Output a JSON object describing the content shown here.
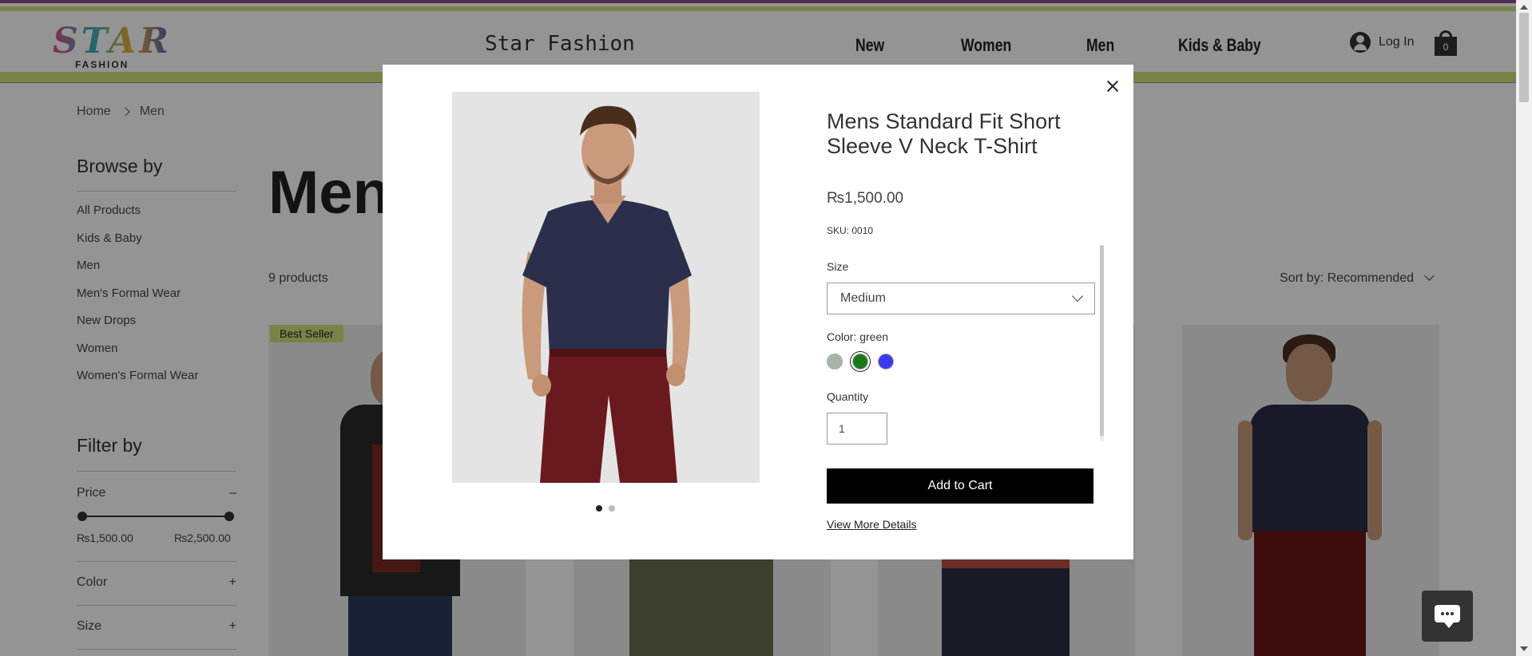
{
  "header": {
    "logo_text": "STAR",
    "logo_sub": "FASHION",
    "site_title": "Star Fashion",
    "nav": [
      "New",
      "Women",
      "Men",
      "Kids & Baby"
    ],
    "login_label": "Log In",
    "cart_count": "0"
  },
  "breadcrumb": [
    "Home",
    "Men"
  ],
  "sidebar": {
    "browse_title": "Browse by",
    "categories": [
      "All Products",
      "Kids & Baby",
      "Men",
      "Men's Formal Wear",
      "New Drops",
      "Women",
      "Women's Formal Wear"
    ],
    "filter_title": "Filter by",
    "price_label": "Price",
    "price_toggle": "–",
    "price_min": "₨1,500.00",
    "price_max": "₨2,500.00",
    "color_label": "Color",
    "size_label": "Size",
    "expand_glyph": "+"
  },
  "main": {
    "title": "Men",
    "count": "9 products",
    "sort_label": "Sort by: Recommended",
    "badge": "Best Seller"
  },
  "modal": {
    "title": "Mens Standard Fit Short Sleeve V Neck T-Shirt",
    "price": "₨1,500.00",
    "sku": "SKU: 0010",
    "size_label": "Size",
    "size_value": "Medium",
    "color_label": "Color: green",
    "colors": [
      "#a8b4a8",
      "#1a7a1a",
      "#3a3af0"
    ],
    "selected_color_index": 1,
    "quantity_label": "Quantity",
    "quantity_value": "1",
    "add_to_cart": "Add to Cart",
    "view_more": "View More Details",
    "image_count": 2,
    "active_image": 0
  }
}
